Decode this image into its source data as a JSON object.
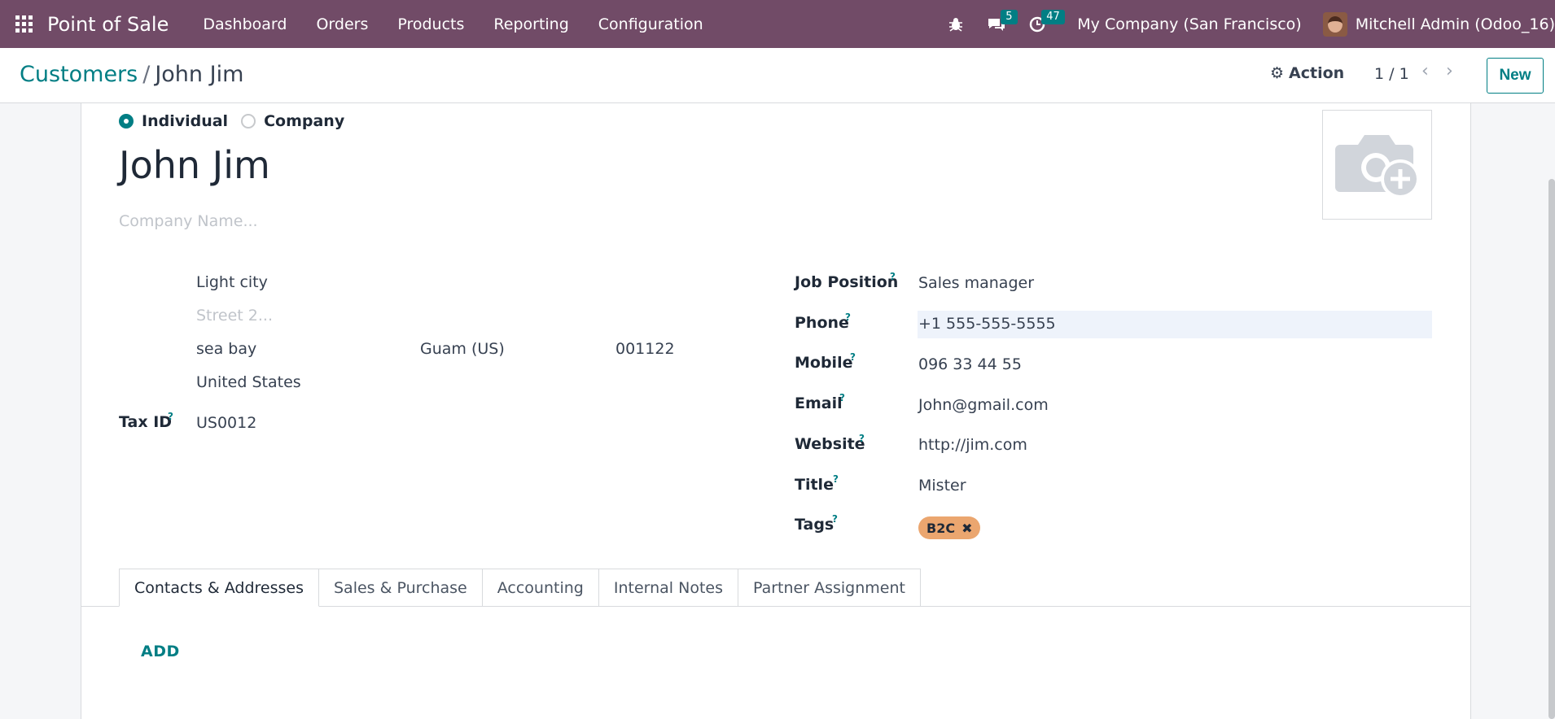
{
  "nav": {
    "app_title": "Point of Sale",
    "menu": [
      "Dashboard",
      "Orders",
      "Products",
      "Reporting",
      "Configuration"
    ],
    "messages_count": "5",
    "activities_count": "47",
    "company": "My Company (San Francisco)",
    "user": "Mitchell Admin (Odoo_16)"
  },
  "control": {
    "breadcrumb_parent": "Customers",
    "breadcrumb_sep": "/",
    "breadcrumb_current": "John Jim",
    "action_label": "Action",
    "pager": "1 / 1",
    "new_label": "New"
  },
  "form": {
    "type_individual": "Individual",
    "type_company": "Company",
    "name": "John Jim",
    "company_name_placeholder": "Company Name...",
    "address": {
      "street": "Light city",
      "street2_placeholder": "Street 2...",
      "city": "sea bay",
      "state": "Guam (US)",
      "zip": "001122",
      "country": "United States"
    },
    "tax_id_label": "Tax ID",
    "tax_id": "US0012",
    "job_position_label": "Job Position",
    "job_position": "Sales manager",
    "phone_label": "Phone",
    "phone": "+1 555-555-5555",
    "mobile_label": "Mobile",
    "mobile": "096 33 44 55",
    "email_label": "Email",
    "email": "John@gmail.com",
    "website_label": "Website",
    "website": "http://jim.com",
    "title_label": "Title",
    "title": "Mister",
    "tags_label": "Tags",
    "tag": "B2C",
    "help_mark": "?"
  },
  "tabs": [
    "Contacts & Addresses",
    "Sales & Purchase",
    "Accounting",
    "Internal Notes",
    "Partner Assignment"
  ],
  "contacts": {
    "add_label": "ADD"
  },
  "colors": {
    "navbar": "#714b67",
    "accent": "#017e84",
    "tag": "#eba66f",
    "badge": "#017e84"
  }
}
